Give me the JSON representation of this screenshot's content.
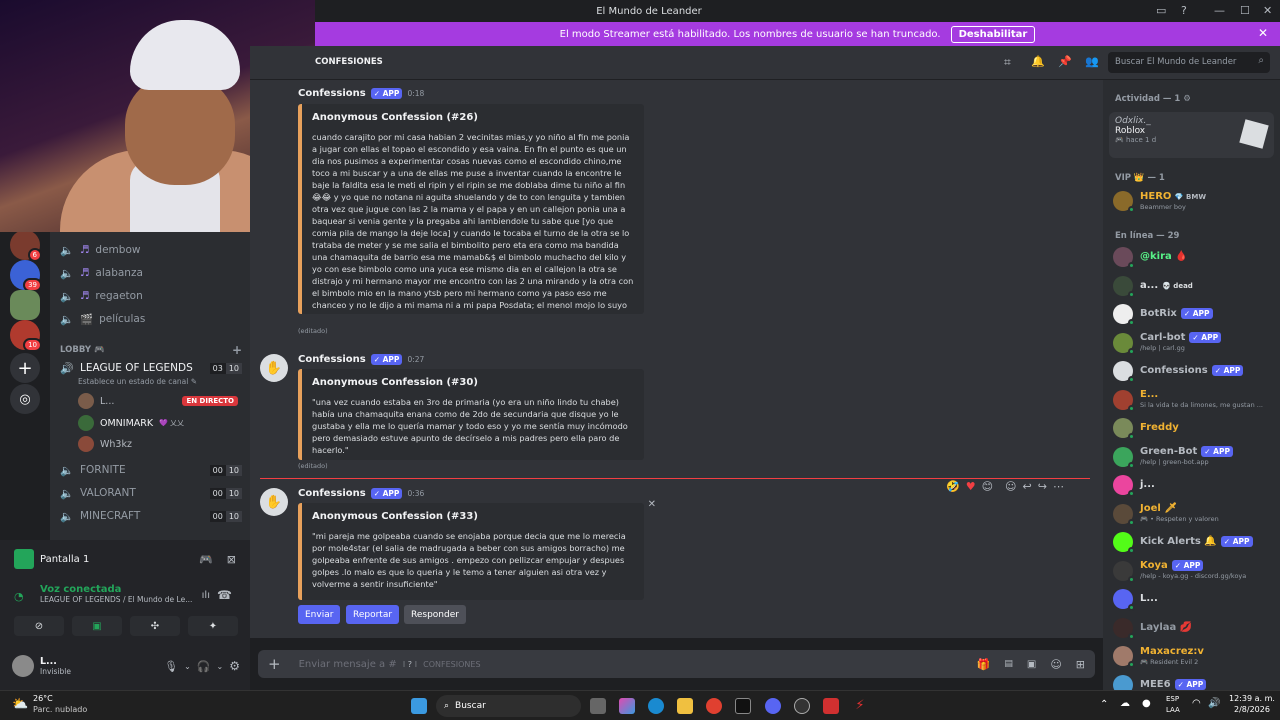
{
  "window": {
    "title": "El Mundo de Leander"
  },
  "streamer_bar": {
    "text": "El modo Streamer está habilitado. Los nombres de usuario se han truncado.",
    "button": "Deshabilitar"
  },
  "guilds": [
    {
      "badge": "6",
      "color": "#7a3b2e"
    },
    {
      "badge": "39",
      "color": "#3b62d6"
    },
    {
      "badge": "",
      "color": "#6a8a5a"
    },
    {
      "badge": "10",
      "color": "#b03a2e"
    }
  ],
  "channels": {
    "items": [
      {
        "icon": "♬",
        "label": "dembow"
      },
      {
        "icon": "♬",
        "label": "alabanza"
      },
      {
        "icon": "♬",
        "label": "regaeton"
      },
      {
        "icon": "🎬",
        "label": "películas"
      }
    ],
    "category": "LOBBY 🎮",
    "voice_channels": [
      {
        "label": "LEAGUE OF LEGENDS",
        "status": "Establece un estado de canal ✎",
        "count": "03",
        "max": "10",
        "active": true
      },
      {
        "label": "FORNITE",
        "count": "00",
        "max": "10"
      },
      {
        "label": "VALORANT",
        "count": "00",
        "max": "10"
      },
      {
        "label": "MINECRAFT",
        "count": "00",
        "max": "10"
      }
    ],
    "voice_users": [
      {
        "name": "L...",
        "badge": "EN DIRECTO"
      },
      {
        "name": "OMNIMARK",
        "badge": "💜 乂乂"
      },
      {
        "name": "Wh3kz",
        "badge": ""
      }
    ]
  },
  "voice_panel": {
    "screen_label": "Pantalla 1",
    "status": "Voz conectada",
    "location": "LEAGUE OF LEGENDS / El Mundo de Le...",
    "user_name": "L...",
    "user_status": "Invisible"
  },
  "channel_header": {
    "name": "CONFESIONES",
    "search_placeholder": "Buscar El Mundo de Leander"
  },
  "messages": [
    {
      "author": "Confessions",
      "tag": "✓ APP",
      "time": "0:18",
      "title": "Anonymous Confession (#26)",
      "text": "cuando carajito por mi casa habian 2 vecinitas mias,y yo niño al fin me ponia a jugar con ellas el topao el escondido y esa vaina. En fin el punto es que un dia nos pusimos a experimentar cosas nuevas como el escondido chino,me toco a mi buscar y a una de ellas me puse a inventar cuando la encontre le baje la faldita esa le meti el ripin y el ripin se me doblaba dime tu niño al fin 😂😂 y yo que no notana ni aguita shuelando y de to con lenguita y tambien otra vez que jugue con las 2 la mama y el papa y en un callejon ponia una a baquear si venia gente y la pregaba ahi lambiendole tu sabe que [yo que comia pila de mango la deje loca] y cuando le tocaba el turno de la otra se lo trataba de meter y se me salia el bimbolito pero eta era como ma bandida una chamaquita de barrio esa me mamab&$ el bimbolo muchacho del kilo y yo con ese bimbolo como una yuca ese mismo dia en el callejon la otra se distrajo y mi hermano mayor me encontro con las 2 una mirando y la otra con el bimbolo mio en la mano ytsb pero mi hermano como ya paso eso me chanceo y no le dijo a mi mama ni a mi papa Posdata; el menol mojo lo suyo temprano ;p\"",
      "edited": "(editado)"
    },
    {
      "author": "Confessions",
      "tag": "✓ APP",
      "time": "0:27",
      "title": "Anonymous Confession (#30)",
      "text": "\"una vez cuando estaba en 3ro de primaria (yo era un niño lindo tu chabe) había una chamaquita enana como de 2do de secundaria que disque yo le gustaba y ella me lo quería mamar y todo eso y yo me sentía muy incómodo pero demasiado estuve apunto de decírselo a mis padres pero ella paro de hacerlo.\"",
      "edited": "(editado)"
    },
    {
      "author": "Confessions",
      "tag": "✓ APP",
      "time": "0:36",
      "title": "Anonymous Confession (#33)",
      "text": "\"mi pareja me golpeaba cuando se enojaba porque decia que me lo merecia por mole4star (el salia de madrugada a beber con sus amigos borracho) me golpeaba enfrente de sus amigos . empezo con pellizcar empujar y despues golpes .lo malo es que lo queria y le temo a tener alguien asi otra vez y volverme a sentir insuficiente\""
    }
  ],
  "action_buttons": {
    "send": "Enviar",
    "report": "Reportar",
    "reply": "Responder"
  },
  "composer": {
    "placeholder": "Enviar mensaje a #",
    "channel": "CONFESIONES"
  },
  "members": {
    "activity_header": "Actividad — 1 ⚙",
    "activity": {
      "name": "Odxlix._",
      "game": "Roblox",
      "time": "🎮 hace 1 d"
    },
    "vip_header": "VIP 👑 — 1",
    "vip": [
      {
        "name": "HERO",
        "extra": "💎 BMW",
        "sub": "Beammer boy",
        "color": "#f0b232",
        "av": "#8a6a2a"
      }
    ],
    "online_header": "En línea — 29",
    "online": [
      {
        "name": "@kira 🩸",
        "sub": "",
        "color": "#57f287",
        "av": "#6a4a5a",
        "app": false
      },
      {
        "name": "a...",
        "sub": "",
        "color": "#dbdee1",
        "av": "#3a4a3a",
        "app": false,
        "extra": "💀 dead"
      },
      {
        "name": "BotRix",
        "sub": "",
        "color": "#b5bac1",
        "av": "#eeeeee",
        "app": true
      },
      {
        "name": "Carl-bot",
        "sub": "/help | carl.gg",
        "color": "#b5bac1",
        "av": "#6a8a3a",
        "app": true
      },
      {
        "name": "Confessions",
        "sub": "",
        "color": "#b5bac1",
        "av": "#dbdee1",
        "app": true
      },
      {
        "name": "E...",
        "sub": "Si la vida te da limones, me gustan ...",
        "color": "#f0b232",
        "av": "#a04030",
        "app": false
      },
      {
        "name": "Freddy",
        "sub": "",
        "color": "#f0b232",
        "av": "#7a8a5a",
        "app": false
      },
      {
        "name": "Green-Bot",
        "sub": "/help | green-bot.app",
        "color": "#b5bac1",
        "av": "#3ba55c",
        "app": true
      },
      {
        "name": "j...",
        "sub": "",
        "color": "#dbdee1",
        "av": "#eb459e",
        "app": false
      },
      {
        "name": "Joel 🗡",
        "sub": "🎮 • Respeten y valoren",
        "color": "#f0b232",
        "av": "#5a4a3a",
        "app": false
      },
      {
        "name": "Kick Alerts 🔔",
        "sub": "",
        "color": "#b5bac1",
        "av": "#53fc18",
        "app": true
      },
      {
        "name": "Koya",
        "sub": "/help - koya.gg - discord.gg/koya",
        "color": "#f0b232",
        "av": "#3a3a3a",
        "app": true
      },
      {
        "name": "L...",
        "sub": "",
        "color": "#dbdee1",
        "av": "#5865f2",
        "app": false
      },
      {
        "name": "Laylaa 💋",
        "sub": "",
        "color": "#949ba4",
        "av": "#3a2a2a",
        "app": false
      },
      {
        "name": "Maxacrez:v",
        "sub": "🎮 Resident Evil 2",
        "color": "#f0b232",
        "av": "#a07a6a",
        "app": false
      },
      {
        "name": "MEE6",
        "sub": "",
        "color": "#b5bac1",
        "av": "#4a9ad0",
        "app": true
      }
    ],
    "app_tag": "✓ APP"
  },
  "taskbar": {
    "weather_temp": "26°C",
    "weather_desc": "Parc. nublado",
    "search": "Buscar",
    "lang": "ESP",
    "region": "LAA",
    "time": "12:39 a. m.",
    "date": "2/8/2026"
  },
  "colors": {
    "accent": "#5865f2",
    "streamer": "#a53be0",
    "embed_border": "#e8a15c",
    "online": "#23a55a",
    "live": "#da373c"
  }
}
